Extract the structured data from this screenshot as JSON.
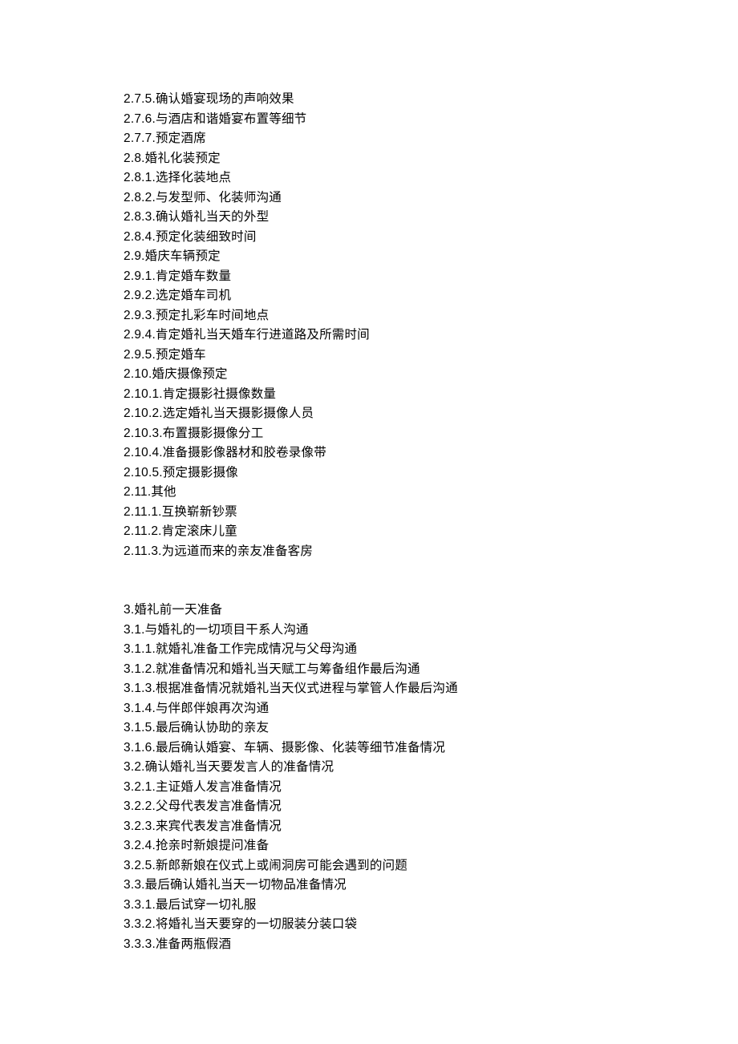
{
  "lines": [
    "2.7.5.确认婚宴现场的声响效果",
    "2.7.6.与酒店和谐婚宴布置等细节",
    "2.7.7.预定酒席",
    "2.8.婚礼化装预定",
    "2.8.1.选择化装地点",
    "2.8.2.与发型师、化装师沟通",
    "2.8.3.确认婚礼当天的外型",
    "2.8.4.预定化装细致时间",
    "2.9.婚庆车辆预定",
    "2.9.1.肯定婚车数量",
    "2.9.2.选定婚车司机",
    "2.9.3.预定扎彩车时间地点",
    "2.9.4.肯定婚礼当天婚车行进道路及所需时间",
    "2.9.5.预定婚车",
    "2.10.婚庆摄像预定",
    "2.10.1.肯定摄影社摄像数量",
    "2.10.2.选定婚礼当天摄影摄像人员",
    "2.10.3.布置摄影摄像分工",
    "2.10.4.准备摄影像器材和胶卷录像带",
    "2.10.5.预定摄影摄像",
    "2.11.其他",
    "2.11.1.互换崭新钞票",
    "2.11.2.肯定滚床儿童",
    "2.11.3.为远道而来的亲友准备客房",
    "",
    "3.婚礼前一天准备",
    "3.1.与婚礼的一切项目干系人沟通",
    "3.1.1.就婚礼准备工作完成情况与父母沟通",
    "3.1.2.就准备情况和婚礼当天赋工与筹备组作最后沟通",
    "3.1.3.根据准备情况就婚礼当天仪式进程与掌管人作最后沟通",
    "3.1.4.与伴郎伴娘再次沟通",
    "3.1.5.最后确认协助的亲友",
    "3.1.6.最后确认婚宴、车辆、摄影像、化装等细节准备情况",
    "3.2.确认婚礼当天要发言人的准备情况",
    "3.2.1.主证婚人发言准备情况",
    "3.2.2.父母代表发言准备情况",
    "3.2.3.来宾代表发言准备情况",
    "3.2.4.抢亲时新娘提问准备",
    "3.2.5.新郎新娘在仪式上或闹洞房可能会遇到的问题",
    "3.3.最后确认婚礼当天一切物品准备情况",
    "3.3.1.最后试穿一切礼服",
    "3.3.2.将婚礼当天要穿的一切服装分装口袋",
    "3.3.3.准备两瓶假酒"
  ]
}
